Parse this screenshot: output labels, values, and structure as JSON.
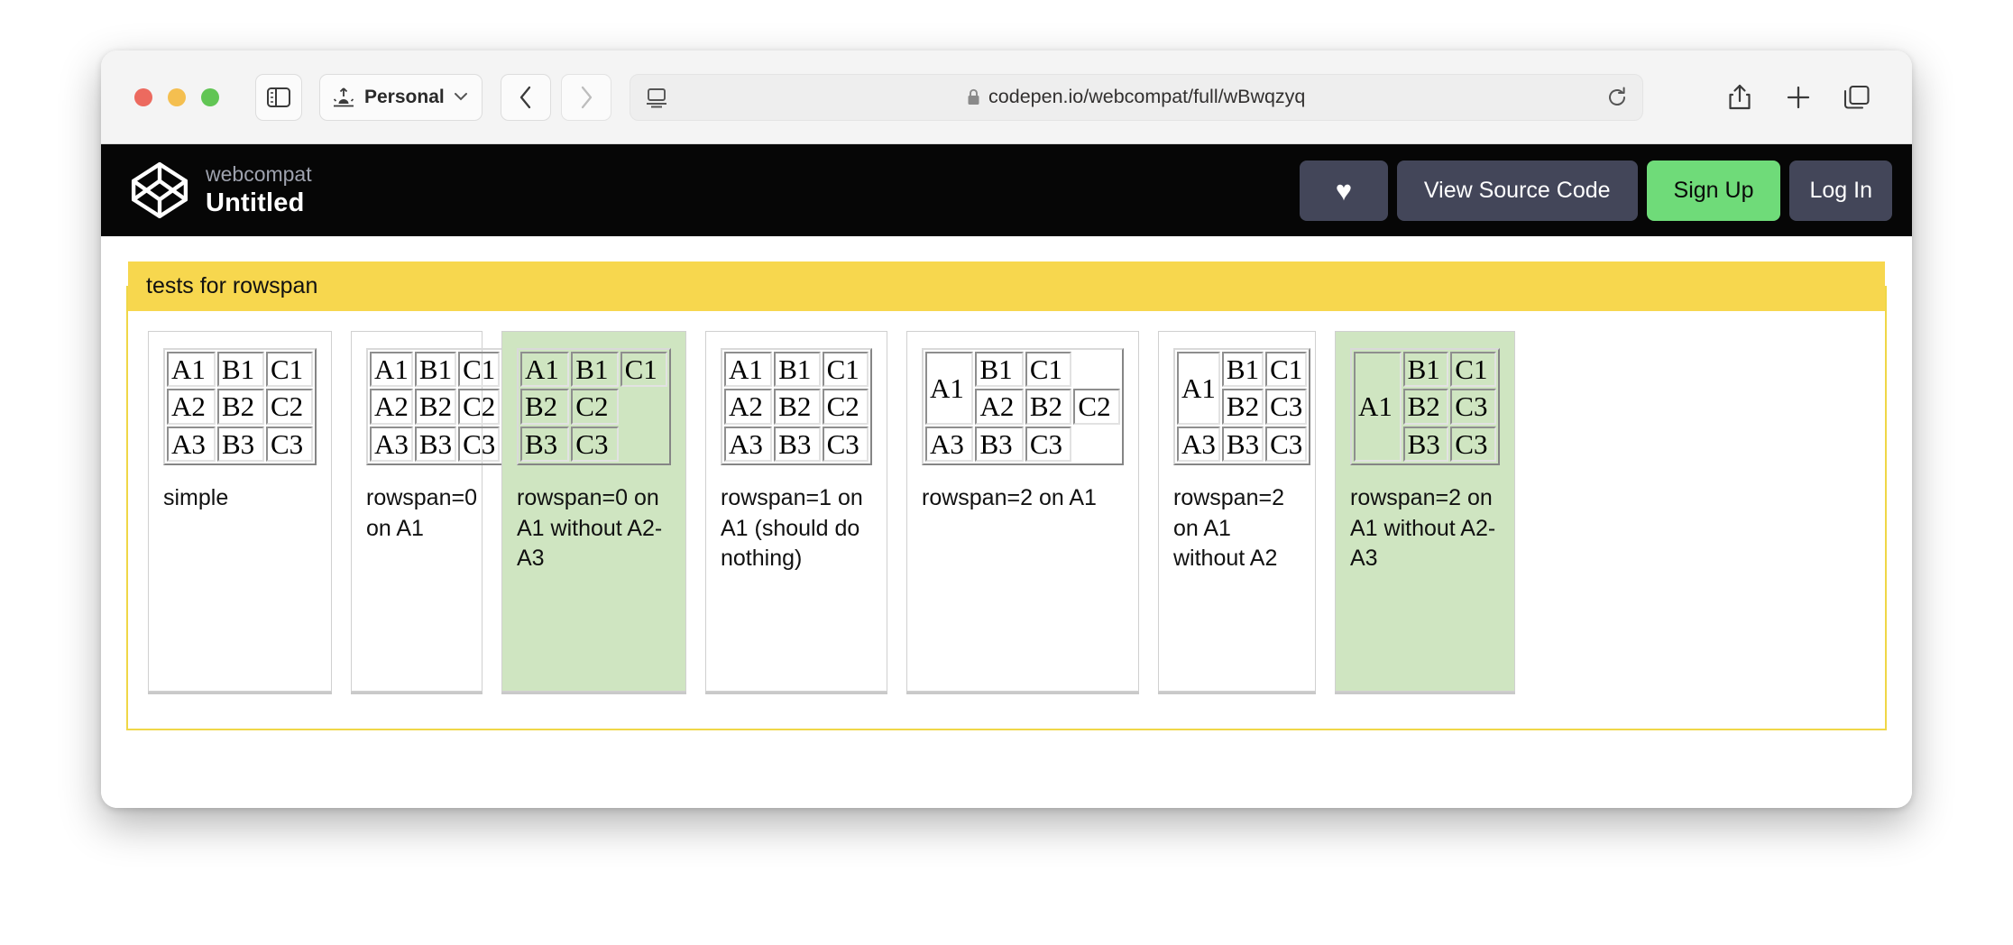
{
  "browser": {
    "profile_label": "Personal",
    "url": "codepen.io/webcompat/full/wBwqzyq",
    "icons": {
      "sidebar": "sidebar-icon",
      "profile": "profile-icon",
      "back": "chevron-left-icon",
      "forward": "chevron-right-icon",
      "reader": "reader-view-icon",
      "lock": "lock-icon",
      "reload": "reload-icon",
      "share": "share-icon",
      "new_tab": "plus-icon",
      "tab_overview": "tab-overview-icon"
    }
  },
  "pen_header": {
    "owner": "webcompat",
    "title": "Untitled",
    "heart_label": "♥",
    "view_source_label": "View Source Code",
    "sign_up_label": "Sign Up",
    "log_in_label": "Log In",
    "colors": {
      "background": "#060606",
      "button": "#434659",
      "signup": "#6fdb79"
    }
  },
  "page": {
    "legend": "tests for rowspan",
    "colors": {
      "legend_background": "#f7d74e",
      "border": "#f0d747",
      "pass_background": "#cfe5c1"
    },
    "cards": [
      {
        "id": "card-1",
        "caption": "simple",
        "pass": false,
        "rows": [
          [
            {
              "text": "A1"
            },
            {
              "text": "B1"
            },
            {
              "text": "C1"
            }
          ],
          [
            {
              "text": "A2"
            },
            {
              "text": "B2"
            },
            {
              "text": "C2"
            }
          ],
          [
            {
              "text": "A3"
            },
            {
              "text": "B3"
            },
            {
              "text": "C3"
            }
          ]
        ]
      },
      {
        "id": "card-2",
        "caption": "rowspan=0 on A1",
        "pass": false,
        "rows": [
          [
            {
              "text": "A1"
            },
            {
              "text": "B1"
            },
            {
              "text": "C1"
            }
          ],
          [
            {
              "text": "A2"
            },
            {
              "text": "B2"
            },
            {
              "text": "C2"
            }
          ],
          [
            {
              "text": "A3"
            },
            {
              "text": "B3"
            },
            {
              "text": "C3"
            }
          ]
        ]
      },
      {
        "id": "card-3",
        "caption": "rowspan=0 on A1 without A2-A3",
        "pass": true,
        "rows": [
          [
            {
              "text": "A1"
            },
            {
              "text": "B1"
            },
            {
              "text": "C1"
            }
          ],
          [
            {
              "text": "B2"
            },
            {
              "text": "C2"
            }
          ],
          [
            {
              "text": "B3"
            },
            {
              "text": "C3"
            }
          ]
        ]
      },
      {
        "id": "card-4",
        "caption": "rowspan=1 on A1 (should do nothing)",
        "pass": false,
        "rows": [
          [
            {
              "text": "A1"
            },
            {
              "text": "B1"
            },
            {
              "text": "C1"
            }
          ],
          [
            {
              "text": "A2"
            },
            {
              "text": "B2"
            },
            {
              "text": "C2"
            }
          ],
          [
            {
              "text": "A3"
            },
            {
              "text": "B3"
            },
            {
              "text": "C3"
            }
          ]
        ]
      },
      {
        "id": "card-5",
        "caption": "rowspan=2 on A1",
        "pass": false,
        "rows": [
          [
            {
              "text": "A1",
              "rowspan": 2
            },
            {
              "text": "B1"
            },
            {
              "text": "C1"
            }
          ],
          [
            {
              "text": "A2"
            },
            {
              "text": "B2"
            },
            {
              "text": "C2"
            }
          ],
          [
            {
              "text": "A3"
            },
            {
              "text": "B3"
            },
            {
              "text": "C3"
            }
          ]
        ]
      },
      {
        "id": "card-6",
        "caption": "rowspan=2 on A1 without A2",
        "pass": false,
        "rows": [
          [
            {
              "text": "A1",
              "rowspan": 2
            },
            {
              "text": "B1"
            },
            {
              "text": "C1"
            }
          ],
          [
            {
              "text": "B2"
            },
            {
              "text": "C3"
            }
          ],
          [
            {
              "text": "A3"
            },
            {
              "text": "B3"
            },
            {
              "text": "C3"
            }
          ]
        ]
      },
      {
        "id": "card-7",
        "caption": "rowspan=2 on A1 without A2-A3",
        "pass": true,
        "rows": [
          [
            {
              "text": "A1",
              "rowspan": 3
            },
            {
              "text": "B1"
            },
            {
              "text": "C1"
            }
          ],
          [
            {
              "text": "B2"
            },
            {
              "text": "C3"
            }
          ],
          [
            {
              "text": "B3"
            },
            {
              "text": "C3"
            }
          ]
        ]
      }
    ]
  }
}
